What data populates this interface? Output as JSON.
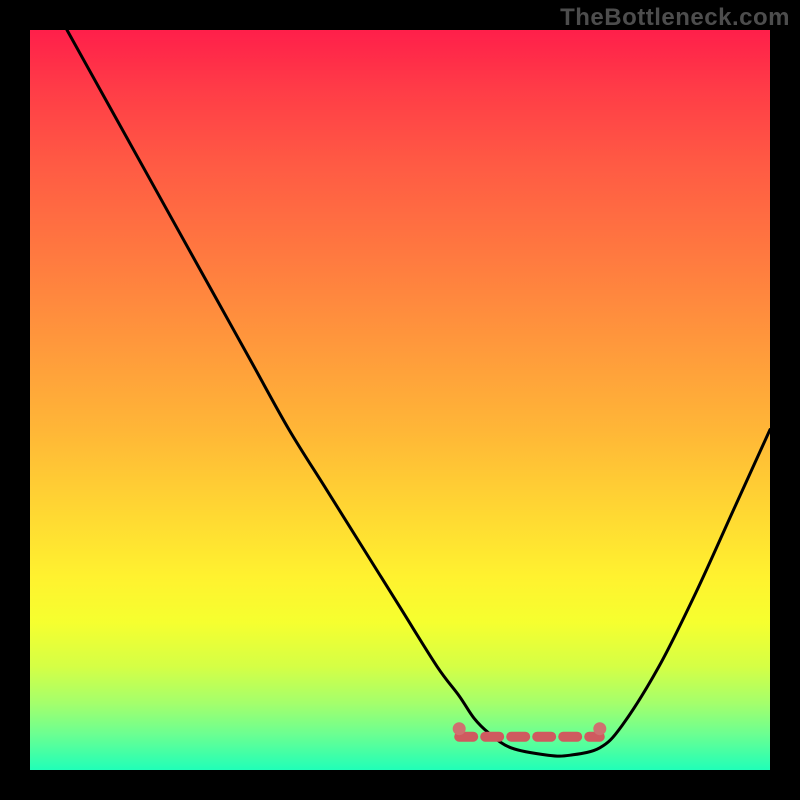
{
  "watermark": "TheBottleneck.com",
  "chart_data": {
    "type": "line",
    "title": "",
    "xlabel": "",
    "ylabel": "",
    "xlim": [
      0,
      100
    ],
    "ylim": [
      0,
      100
    ],
    "grid": false,
    "legend": false,
    "series": [
      {
        "name": "bottleneck-curve",
        "color": "#000000",
        "x": [
          5,
          10,
          15,
          20,
          25,
          30,
          35,
          40,
          45,
          50,
          55,
          58,
          60,
          62,
          65,
          70,
          73,
          77,
          80,
          85,
          90,
          95,
          100
        ],
        "values": [
          100,
          91,
          82,
          73,
          64,
          55,
          46,
          38,
          30,
          22,
          14,
          10,
          7,
          5,
          3,
          2,
          2,
          3,
          6,
          14,
          24,
          35,
          46
        ]
      }
    ],
    "optimal_zone": {
      "name": "flat-region-marker",
      "color": "#cf5a5f",
      "x_start": 58,
      "x_end": 77,
      "y": 4.5
    },
    "gradient_stops": [
      {
        "pos": 0,
        "color": "#ff1f4a"
      },
      {
        "pos": 8,
        "color": "#ff3c47"
      },
      {
        "pos": 18,
        "color": "#ff5a44"
      },
      {
        "pos": 30,
        "color": "#ff7840"
      },
      {
        "pos": 42,
        "color": "#ff973c"
      },
      {
        "pos": 54,
        "color": "#ffb637"
      },
      {
        "pos": 64,
        "color": "#ffd433"
      },
      {
        "pos": 74,
        "color": "#fff22f"
      },
      {
        "pos": 80,
        "color": "#f6ff2f"
      },
      {
        "pos": 86,
        "color": "#d5ff45"
      },
      {
        "pos": 91,
        "color": "#a4ff6c"
      },
      {
        "pos": 95,
        "color": "#6eff90"
      },
      {
        "pos": 98,
        "color": "#3fffa8"
      },
      {
        "pos": 100,
        "color": "#20ffb8"
      }
    ]
  }
}
